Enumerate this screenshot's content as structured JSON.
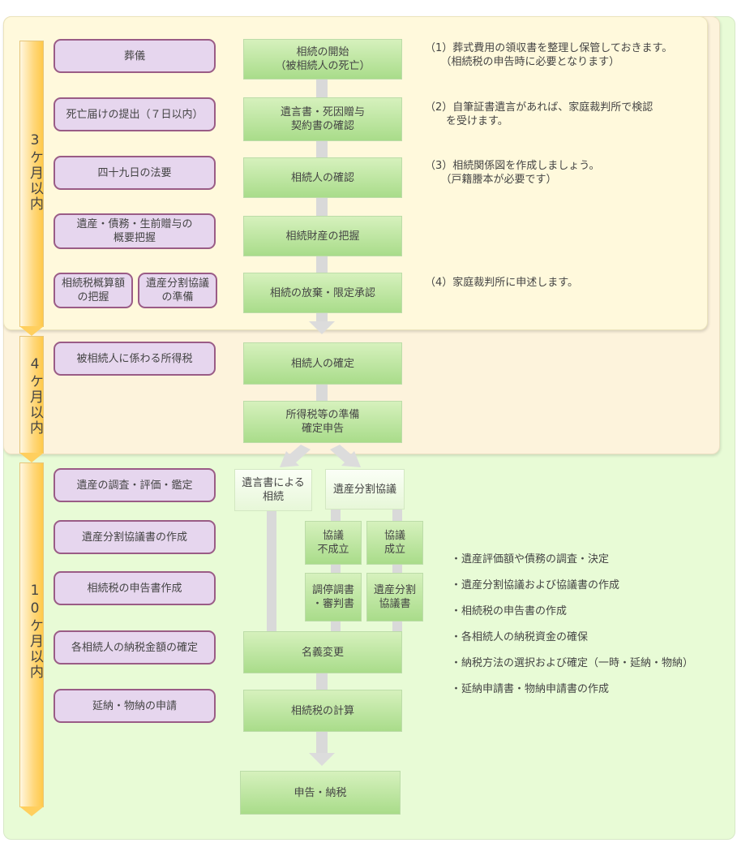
{
  "phases": [
    {
      "id": "3m",
      "label": "3ケ月以内"
    },
    {
      "id": "4m",
      "label": "4ケ月以内"
    },
    {
      "id": "10m",
      "label": "10ケ月以内"
    }
  ],
  "tasks": [
    "葬儀",
    "死亡届けの提出（７日以内）",
    "四十九日の法要",
    "遺産・債務・生前贈与の\n概要把握",
    "相続税概算額\nの把握",
    "遺産分割協議\nの準備",
    "被相続人に係わる所得税",
    "遺産の調査・評価・鑑定",
    "遺産分割協議書の作成",
    "相続税の申告書作成",
    "各相続人の納税金額の確定",
    "延納・物納の申請"
  ],
  "flow": [
    "相続の開始\n（被相続人の死亡）",
    "遺言書・死因贈与\n契約書の確認",
    "相続人の確認",
    "相続財産の把握",
    "相続の放棄・限定承認",
    "相続人の確定",
    "所得税等の準備\n確定申告",
    "遺言書による\n相続",
    "遺産分割協議",
    "協議\n不成立",
    "協議\n成立",
    "調停調書\n・審判書",
    "遺産分割\n協議書",
    "名義変更",
    "相続税の計算",
    "申告・納税"
  ],
  "notes": [
    "（1）葬式費用の領収書を整理し保管しておきます。\n　　（相続税の申告時に必要となります）",
    "（2）自筆証書遺言があれば、家庭裁判所で検認\n　　を受けます。",
    "（3）相続関係図を作成しましょう。\n　　（戸籍謄本が必要です）",
    "（4）家庭裁判所に申述します。"
  ],
  "bullets": [
    "・遺産評価額や債務の調査・決定",
    "・遺産分割協議および協議書の作成",
    "・相続税の申告書の作成",
    "・各相続人の納税資金の確保",
    "・納税方法の選択および確定（一時・延納・物納）",
    "・延納申請書・物納申請書の作成"
  ]
}
